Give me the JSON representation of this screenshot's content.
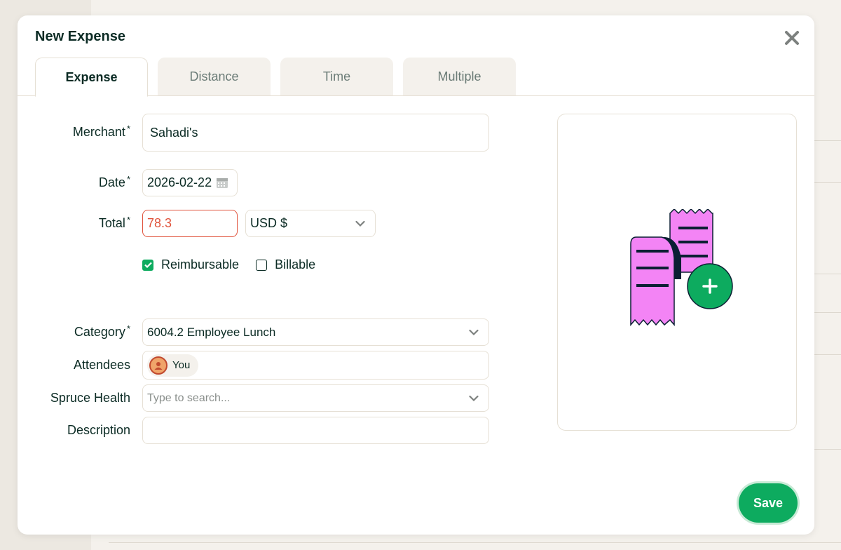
{
  "modal": {
    "title": "New Expense",
    "close_icon": "close-icon"
  },
  "tabs": [
    {
      "label": "Expense",
      "active": true
    },
    {
      "label": "Distance",
      "active": false
    },
    {
      "label": "Time",
      "active": false
    },
    {
      "label": "Multiple",
      "active": false
    }
  ],
  "form": {
    "merchant": {
      "label": "Merchant",
      "value": "Sahadi's"
    },
    "date": {
      "label": "Date",
      "value": "2026-02-22",
      "icon": "calendar-icon"
    },
    "total": {
      "label": "Total",
      "value": "78.3",
      "currency": "USD $"
    },
    "reimbursable": {
      "label": "Reimbursable",
      "checked": true
    },
    "billable": {
      "label": "Billable",
      "checked": false
    },
    "category": {
      "label": "Category",
      "value": "6004.2 Employee Lunch"
    },
    "attendees": {
      "label": "Attendees",
      "chip": "You"
    },
    "spruce_health": {
      "label": "Spruce Health",
      "placeholder": "Type to search..."
    },
    "description": {
      "label": "Description",
      "value": ""
    },
    "required_mark": "*"
  },
  "receipt": {
    "icon": "add-receipt-icon"
  },
  "footer": {
    "save_label": "Save"
  },
  "colors": {
    "accent": "#0dab5f",
    "error": "#e0533c",
    "text": "#0b2b24",
    "receipt_pink": "#f384f5"
  }
}
